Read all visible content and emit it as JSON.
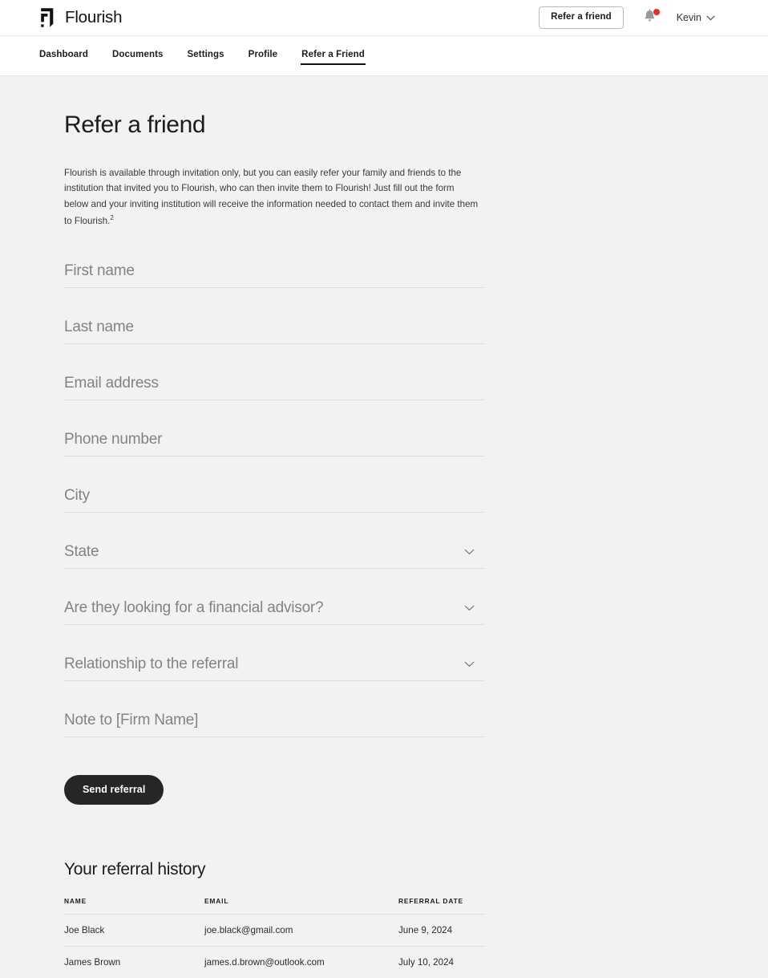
{
  "header": {
    "brand_name": "Flourish",
    "brand_logo_icon": "flourish-logo-icon",
    "refer_button_label": "Refer a friend",
    "notifications_icon": "bell-icon",
    "user_name": "Kevin",
    "user_chevron_icon": "chevron-down-icon"
  },
  "nav": {
    "items": [
      {
        "label": "Dashboard",
        "active": false
      },
      {
        "label": "Documents",
        "active": false
      },
      {
        "label": "Settings",
        "active": false
      },
      {
        "label": "Profile",
        "active": false
      },
      {
        "label": "Refer a Friend",
        "active": true
      }
    ]
  },
  "main": {
    "title": "Refer a friend",
    "intro": "Flourish is available through invitation only, but you can easily refer your family and friends to the institution that invited you to Flourish, who can then invite them to Flourish! Just fill out the form below and your inviting institution will receive the information needed to contact them and invite them to Flourish.",
    "intro_footnote_marker": "2"
  },
  "form": {
    "fields": [
      {
        "name": "first-name",
        "type": "text",
        "placeholder": "First name",
        "value": ""
      },
      {
        "name": "last-name",
        "type": "text",
        "placeholder": "Last name",
        "value": ""
      },
      {
        "name": "email-address",
        "type": "text",
        "placeholder": "Email address",
        "value": ""
      },
      {
        "name": "phone-number",
        "type": "text",
        "placeholder": "Phone number",
        "value": ""
      },
      {
        "name": "city",
        "type": "text",
        "placeholder": "City",
        "value": ""
      },
      {
        "name": "state",
        "type": "select",
        "placeholder": "State",
        "value": ""
      },
      {
        "name": "looking-for-financial-advisor",
        "type": "select",
        "placeholder": "Are they looking for a financial advisor?",
        "value": ""
      },
      {
        "name": "relationship-to-referral",
        "type": "select",
        "placeholder": "Relationship to the referral",
        "value": ""
      },
      {
        "name": "note-to-firm",
        "type": "text",
        "placeholder": "Note to [Firm Name]",
        "value": ""
      }
    ],
    "submit_label": "Send referral"
  },
  "history": {
    "title": "Your referral history",
    "columns": [
      "NAME",
      "EMAIL",
      "REFERRAL DATE"
    ],
    "rows": [
      {
        "name": "Joe Black",
        "email": "joe.black@gmail.com",
        "date": "June 9, 2024"
      },
      {
        "name": "James Brown",
        "email": "james.d.brown@outlook.com",
        "date": "July 10, 2024"
      }
    ]
  },
  "colors": {
    "page_background": "#f2f2f2",
    "header_background": "#ffffff",
    "text_primary": "#1c1c1c",
    "placeholder": "#838383",
    "button_dark": "#262626",
    "notification_dot": "#ee2b20",
    "rule": "#dcdcdc"
  }
}
